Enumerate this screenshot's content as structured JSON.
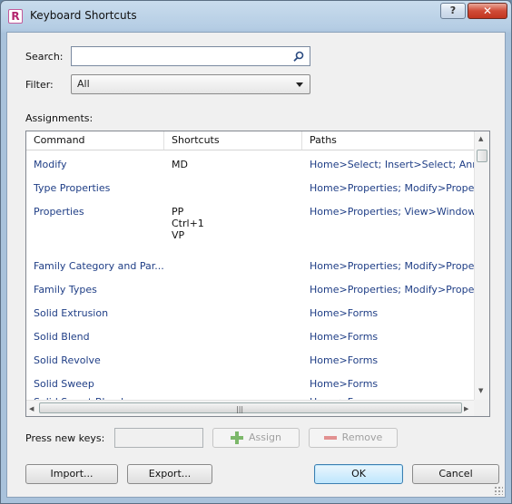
{
  "window": {
    "title": "Keyboard Shortcuts",
    "app_icon": "R",
    "help_label": "?",
    "close_label": "✕"
  },
  "search": {
    "label": "Search:",
    "value": "",
    "placeholder": ""
  },
  "filter": {
    "label": "Filter:",
    "value": "All"
  },
  "assignments": {
    "label": "Assignments:",
    "columns": [
      "Command",
      "Shortcuts",
      "Paths"
    ],
    "rows": [
      {
        "command": "Modify",
        "shortcuts": "MD",
        "paths": "Home>Select; Insert>Select; Ann..."
      },
      {
        "command": "Type Properties",
        "shortcuts": "",
        "paths": "Home>Properties; Modify>Prope..."
      },
      {
        "command": "Properties",
        "shortcuts": "PP\nCtrl+1\nVP",
        "paths": "Home>Properties; View>Window..."
      },
      {
        "command": "Family Category and Par...",
        "shortcuts": "",
        "paths": "Home>Properties; Modify>Prope..."
      },
      {
        "command": "Family Types",
        "shortcuts": "",
        "paths": "Home>Properties; Modify>Prope..."
      },
      {
        "command": "Solid Extrusion",
        "shortcuts": "",
        "paths": "Home>Forms"
      },
      {
        "command": "Solid Blend",
        "shortcuts": "",
        "paths": "Home>Forms"
      },
      {
        "command": "Solid Revolve",
        "shortcuts": "",
        "paths": "Home>Forms"
      },
      {
        "command": "Solid Sweep",
        "shortcuts": "",
        "paths": "Home>Forms"
      },
      {
        "command": "Solid Swept Blend",
        "shortcuts": "",
        "paths": "Home>Forms"
      }
    ]
  },
  "keys": {
    "label": "Press new keys:",
    "value": ""
  },
  "buttons": {
    "assign": "Assign",
    "remove": "Remove",
    "import": "Import...",
    "export": "Export...",
    "ok": "OK",
    "cancel": "Cancel"
  },
  "icons": {
    "search": "search-icon",
    "dropdown": "chevron-down-icon",
    "assign": "plus-icon",
    "remove": "minus-icon"
  }
}
